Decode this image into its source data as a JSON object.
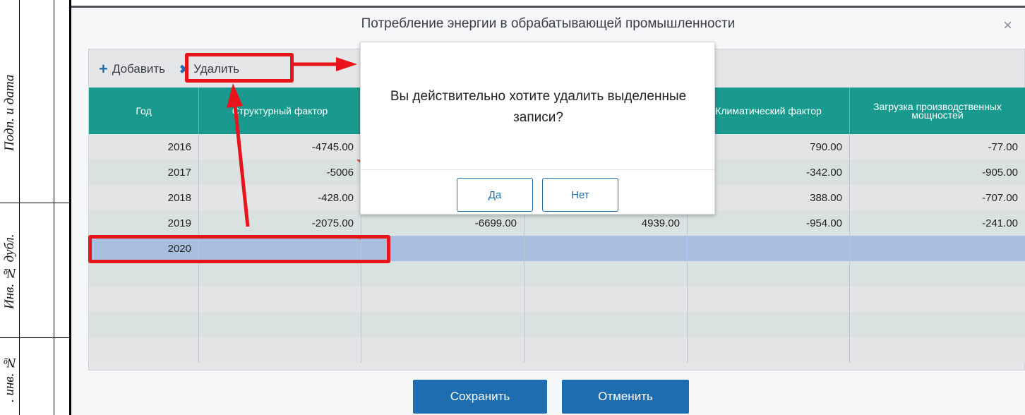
{
  "margin_stamp": {
    "labels": [
      "Подп. и дата",
      "Инв. № дубл.",
      ". инв. №"
    ]
  },
  "dialog": {
    "title": "Потребление энергии в обрабатывающей промышленности",
    "close_icon": "×"
  },
  "toolbar": {
    "add_icon": "+",
    "add_label": "Добавить",
    "delete_icon": "✖",
    "delete_label": "Удалить"
  },
  "table": {
    "columns": [
      "Год",
      "Структурный фактор",
      "",
      "",
      "Климатический фактор",
      "Загрузка производственных мощностей"
    ],
    "rows": [
      {
        "year": "2016",
        "c1": "-4745.00",
        "c2": "",
        "c3": "",
        "c4": "790.00",
        "c5": "-77.00"
      },
      {
        "year": "2017",
        "c1": "-5006",
        "c2": "",
        "c3": "",
        "c4": "-342.00",
        "c5": "-905.00"
      },
      {
        "year": "2018",
        "c1": "-428.00",
        "c2": "",
        "c3": "",
        "c4": "388.00",
        "c5": "-707.00"
      },
      {
        "year": "2019",
        "c1": "-2075.00",
        "c2": "-6699.00",
        "c3": "4939.00",
        "c4": "-954.00",
        "c5": "-241.00"
      },
      {
        "year": "2020",
        "c1": "",
        "c2": "",
        "c3": "",
        "c4": "",
        "c5": ""
      },
      {
        "year": "",
        "c1": "",
        "c2": "",
        "c3": "",
        "c4": "",
        "c5": ""
      },
      {
        "year": "",
        "c1": "",
        "c2": "",
        "c3": "",
        "c4": "",
        "c5": ""
      },
      {
        "year": "",
        "c1": "",
        "c2": "",
        "c3": "",
        "c4": "",
        "c5": ""
      },
      {
        "year": "",
        "c1": "",
        "c2": "",
        "c3": "",
        "c4": "",
        "c5": ""
      }
    ]
  },
  "confirm": {
    "message": "Вы действительно хотите удалить выделенные записи?",
    "yes": "Да",
    "no": "Нет"
  },
  "footer": {
    "save": "Сохранить",
    "cancel": "Отменить"
  },
  "colors": {
    "header_teal": "#1a9a8e",
    "primary_blue": "#1f6db1",
    "annotation_red": "#e8141c",
    "selected_row": "#a8bedf"
  }
}
